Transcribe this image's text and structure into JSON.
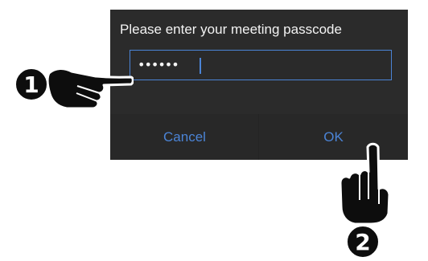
{
  "dialog": {
    "title": "Please enter your meeting passcode",
    "passcode_value": "••••••",
    "cancel_label": "Cancel",
    "ok_label": "OK"
  },
  "annotations": {
    "step_1_label": "1",
    "step_2_label": "2"
  },
  "colors": {
    "dialog_background": "#2b2b2b",
    "accent": "#4b84d6",
    "title_text": "#f3f3f3",
    "callout_background": "#0d0d0d"
  },
  "icons": {
    "step_1_pointer": "pointing-hand-icon",
    "step_2_pointer": "tapping-hand-icon"
  }
}
